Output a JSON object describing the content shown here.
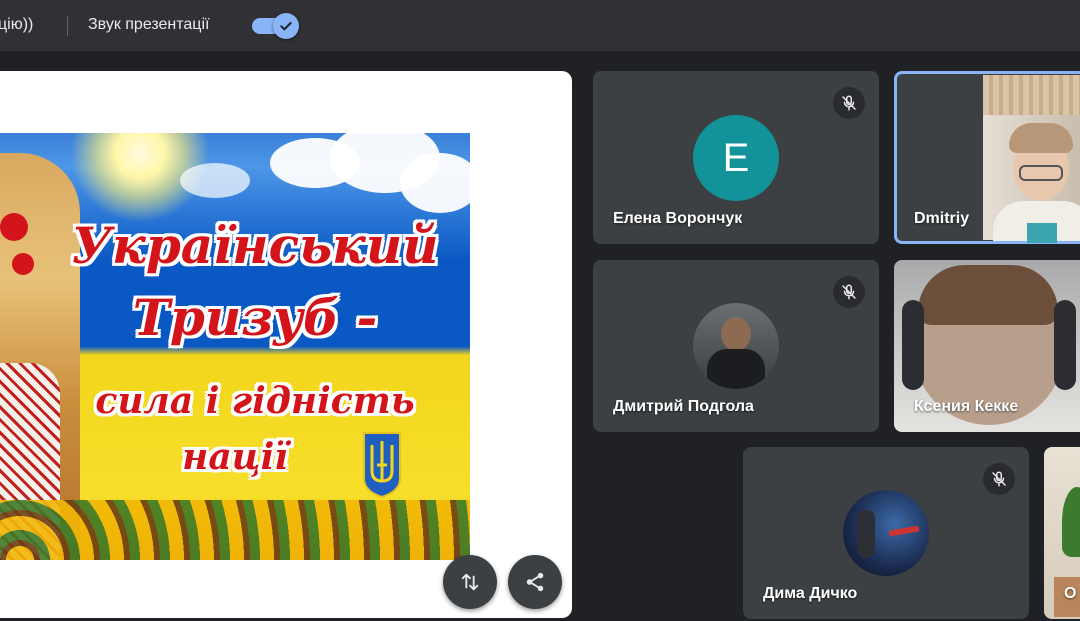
{
  "topbar": {
    "left_text": "цію))",
    "sound_label": "Звук презентації",
    "sound_toggle_on": true,
    "accent_color": "#8ab4f8"
  },
  "presentation": {
    "slide_title_line1": "Український",
    "slide_title_line2": "Тризуб -",
    "slide_title_line3": "сила і гідність",
    "slide_title_line4": "нації",
    "buttons": [
      {
        "icon": "swap-vertical-icon"
      },
      {
        "icon": "share-icon"
      }
    ]
  },
  "participants": [
    {
      "name": "Елена Ворончук",
      "avatar_letter": "E",
      "avatar_color": "#12939a",
      "muted": true,
      "has_video": false
    },
    {
      "name": "Dmitriy",
      "muted": false,
      "has_video": true,
      "active_speaker": true,
      "highlight_color": "#8ab4f8"
    },
    {
      "name": "Дмитрий Подгола",
      "muted": true,
      "has_video": false,
      "avatar_type": "photo"
    },
    {
      "name": "Ксения Кекке",
      "muted": false,
      "has_video": true
    },
    {
      "name": "Дима Дичко",
      "muted": true,
      "has_video": false,
      "avatar_type": "photo"
    },
    {
      "name": "О",
      "muted": false,
      "has_video": true
    }
  ]
}
